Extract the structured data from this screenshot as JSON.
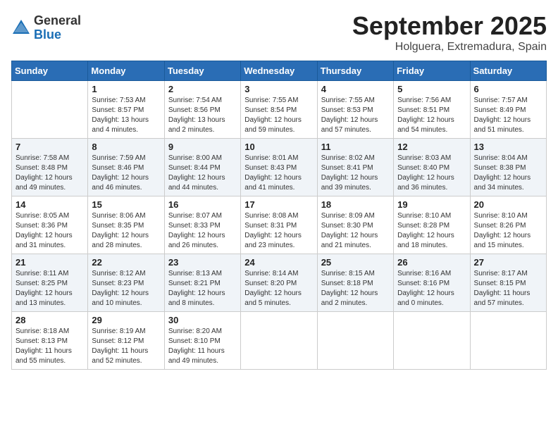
{
  "header": {
    "logo_general": "General",
    "logo_blue": "Blue",
    "month": "September 2025",
    "location": "Holguera, Extremadura, Spain"
  },
  "weekdays": [
    "Sunday",
    "Monday",
    "Tuesday",
    "Wednesday",
    "Thursday",
    "Friday",
    "Saturday"
  ],
  "weeks": [
    [
      {
        "day": "",
        "info": ""
      },
      {
        "day": "1",
        "info": "Sunrise: 7:53 AM\nSunset: 8:57 PM\nDaylight: 13 hours\nand 4 minutes."
      },
      {
        "day": "2",
        "info": "Sunrise: 7:54 AM\nSunset: 8:56 PM\nDaylight: 13 hours\nand 2 minutes."
      },
      {
        "day": "3",
        "info": "Sunrise: 7:55 AM\nSunset: 8:54 PM\nDaylight: 12 hours\nand 59 minutes."
      },
      {
        "day": "4",
        "info": "Sunrise: 7:55 AM\nSunset: 8:53 PM\nDaylight: 12 hours\nand 57 minutes."
      },
      {
        "day": "5",
        "info": "Sunrise: 7:56 AM\nSunset: 8:51 PM\nDaylight: 12 hours\nand 54 minutes."
      },
      {
        "day": "6",
        "info": "Sunrise: 7:57 AM\nSunset: 8:49 PM\nDaylight: 12 hours\nand 51 minutes."
      }
    ],
    [
      {
        "day": "7",
        "info": "Sunrise: 7:58 AM\nSunset: 8:48 PM\nDaylight: 12 hours\nand 49 minutes."
      },
      {
        "day": "8",
        "info": "Sunrise: 7:59 AM\nSunset: 8:46 PM\nDaylight: 12 hours\nand 46 minutes."
      },
      {
        "day": "9",
        "info": "Sunrise: 8:00 AM\nSunset: 8:44 PM\nDaylight: 12 hours\nand 44 minutes."
      },
      {
        "day": "10",
        "info": "Sunrise: 8:01 AM\nSunset: 8:43 PM\nDaylight: 12 hours\nand 41 minutes."
      },
      {
        "day": "11",
        "info": "Sunrise: 8:02 AM\nSunset: 8:41 PM\nDaylight: 12 hours\nand 39 minutes."
      },
      {
        "day": "12",
        "info": "Sunrise: 8:03 AM\nSunset: 8:40 PM\nDaylight: 12 hours\nand 36 minutes."
      },
      {
        "day": "13",
        "info": "Sunrise: 8:04 AM\nSunset: 8:38 PM\nDaylight: 12 hours\nand 34 minutes."
      }
    ],
    [
      {
        "day": "14",
        "info": "Sunrise: 8:05 AM\nSunset: 8:36 PM\nDaylight: 12 hours\nand 31 minutes."
      },
      {
        "day": "15",
        "info": "Sunrise: 8:06 AM\nSunset: 8:35 PM\nDaylight: 12 hours\nand 28 minutes."
      },
      {
        "day": "16",
        "info": "Sunrise: 8:07 AM\nSunset: 8:33 PM\nDaylight: 12 hours\nand 26 minutes."
      },
      {
        "day": "17",
        "info": "Sunrise: 8:08 AM\nSunset: 8:31 PM\nDaylight: 12 hours\nand 23 minutes."
      },
      {
        "day": "18",
        "info": "Sunrise: 8:09 AM\nSunset: 8:30 PM\nDaylight: 12 hours\nand 21 minutes."
      },
      {
        "day": "19",
        "info": "Sunrise: 8:10 AM\nSunset: 8:28 PM\nDaylight: 12 hours\nand 18 minutes."
      },
      {
        "day": "20",
        "info": "Sunrise: 8:10 AM\nSunset: 8:26 PM\nDaylight: 12 hours\nand 15 minutes."
      }
    ],
    [
      {
        "day": "21",
        "info": "Sunrise: 8:11 AM\nSunset: 8:25 PM\nDaylight: 12 hours\nand 13 minutes."
      },
      {
        "day": "22",
        "info": "Sunrise: 8:12 AM\nSunset: 8:23 PM\nDaylight: 12 hours\nand 10 minutes."
      },
      {
        "day": "23",
        "info": "Sunrise: 8:13 AM\nSunset: 8:21 PM\nDaylight: 12 hours\nand 8 minutes."
      },
      {
        "day": "24",
        "info": "Sunrise: 8:14 AM\nSunset: 8:20 PM\nDaylight: 12 hours\nand 5 minutes."
      },
      {
        "day": "25",
        "info": "Sunrise: 8:15 AM\nSunset: 8:18 PM\nDaylight: 12 hours\nand 2 minutes."
      },
      {
        "day": "26",
        "info": "Sunrise: 8:16 AM\nSunset: 8:16 PM\nDaylight: 12 hours\nand 0 minutes."
      },
      {
        "day": "27",
        "info": "Sunrise: 8:17 AM\nSunset: 8:15 PM\nDaylight: 11 hours\nand 57 minutes."
      }
    ],
    [
      {
        "day": "28",
        "info": "Sunrise: 8:18 AM\nSunset: 8:13 PM\nDaylight: 11 hours\nand 55 minutes."
      },
      {
        "day": "29",
        "info": "Sunrise: 8:19 AM\nSunset: 8:12 PM\nDaylight: 11 hours\nand 52 minutes."
      },
      {
        "day": "30",
        "info": "Sunrise: 8:20 AM\nSunset: 8:10 PM\nDaylight: 11 hours\nand 49 minutes."
      },
      {
        "day": "",
        "info": ""
      },
      {
        "day": "",
        "info": ""
      },
      {
        "day": "",
        "info": ""
      },
      {
        "day": "",
        "info": ""
      }
    ]
  ]
}
